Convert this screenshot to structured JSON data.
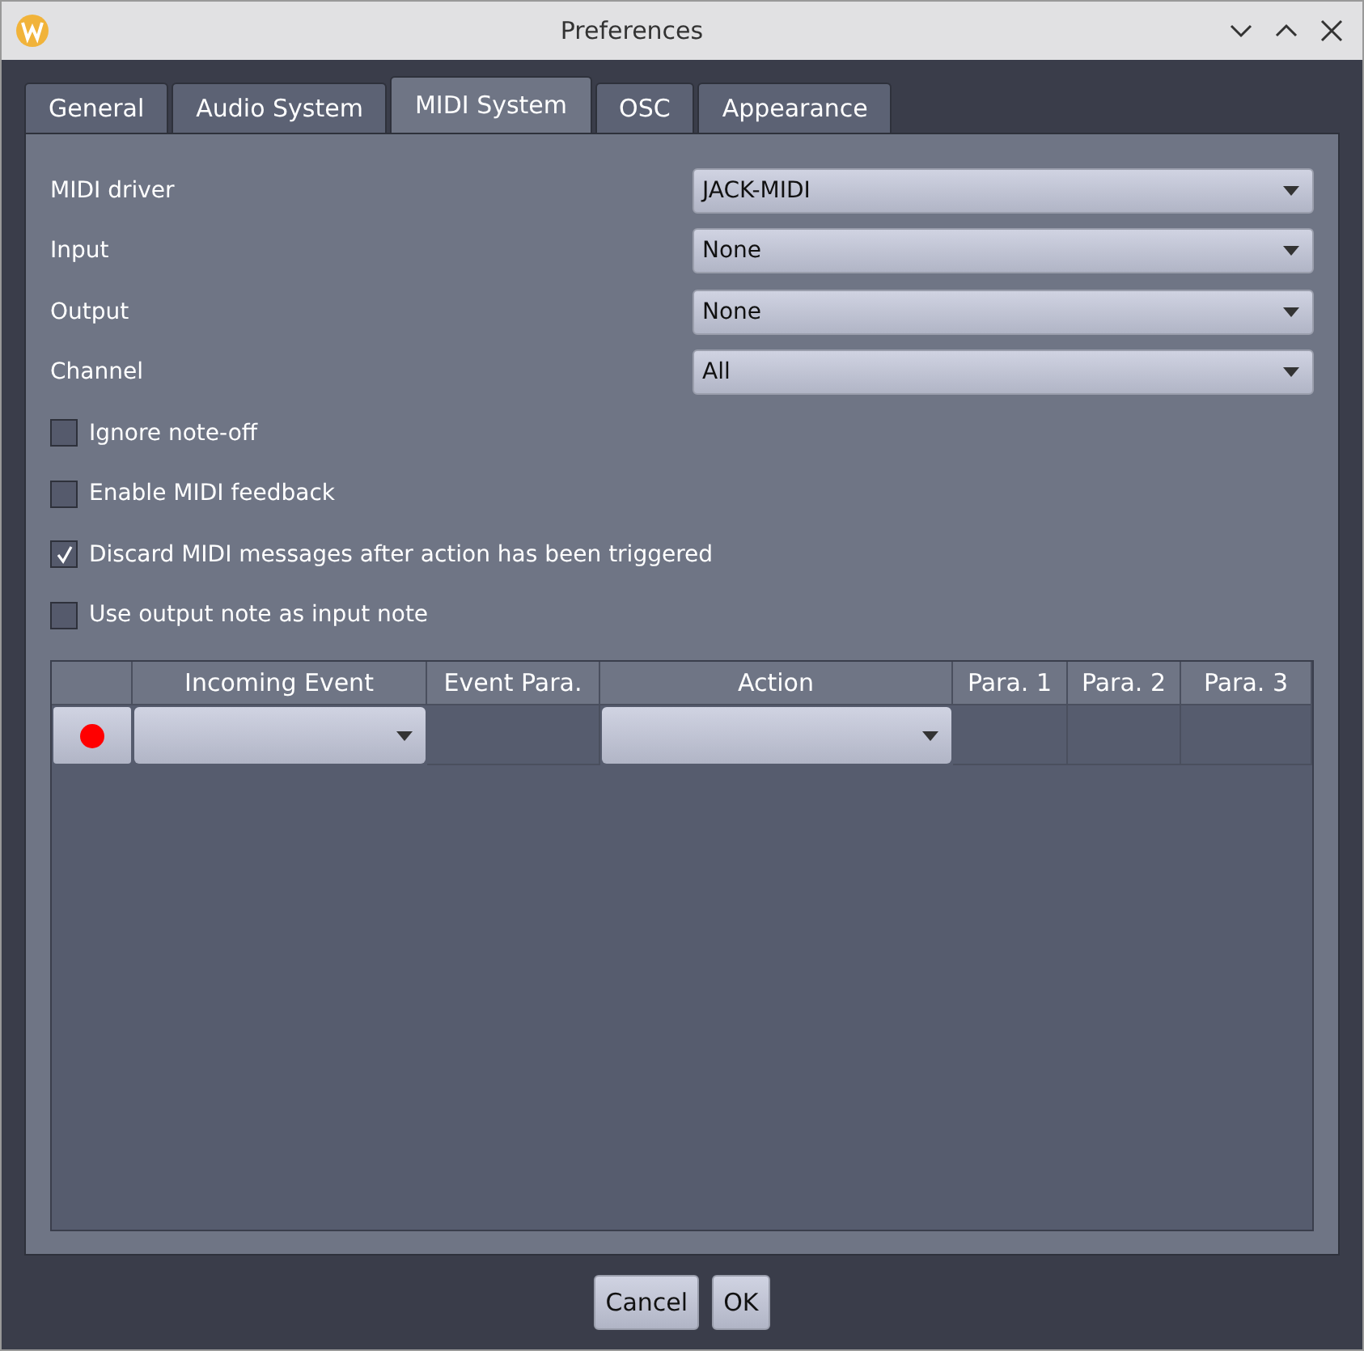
{
  "window": {
    "title": "Preferences"
  },
  "tabs": [
    {
      "label": "General",
      "selected": false
    },
    {
      "label": "Audio System",
      "selected": false
    },
    {
      "label": "MIDI System",
      "selected": true
    },
    {
      "label": "OSC",
      "selected": false
    },
    {
      "label": "Appearance",
      "selected": false
    }
  ],
  "fields": [
    {
      "label": "MIDI driver",
      "value": "JACK-MIDI"
    },
    {
      "label": "Input",
      "value": "None"
    },
    {
      "label": "Output",
      "value": "None"
    },
    {
      "label": "Channel",
      "value": "All"
    }
  ],
  "checkboxes": [
    {
      "label": "Ignore note-off",
      "checked": false
    },
    {
      "label": "Enable MIDI feedback",
      "checked": false
    },
    {
      "label": "Discard MIDI messages after action has been triggered",
      "checked": true
    },
    {
      "label": "Use output note as input note",
      "checked": false
    }
  ],
  "table": {
    "columns": [
      "Incoming Event",
      "Event Para.",
      "Action",
      "Para. 1",
      "Para. 2",
      "Para. 3"
    ],
    "rows": [
      {
        "recording": true
      }
    ]
  },
  "buttons": [
    {
      "label": "Cancel"
    },
    {
      "label": "OK"
    }
  ]
}
